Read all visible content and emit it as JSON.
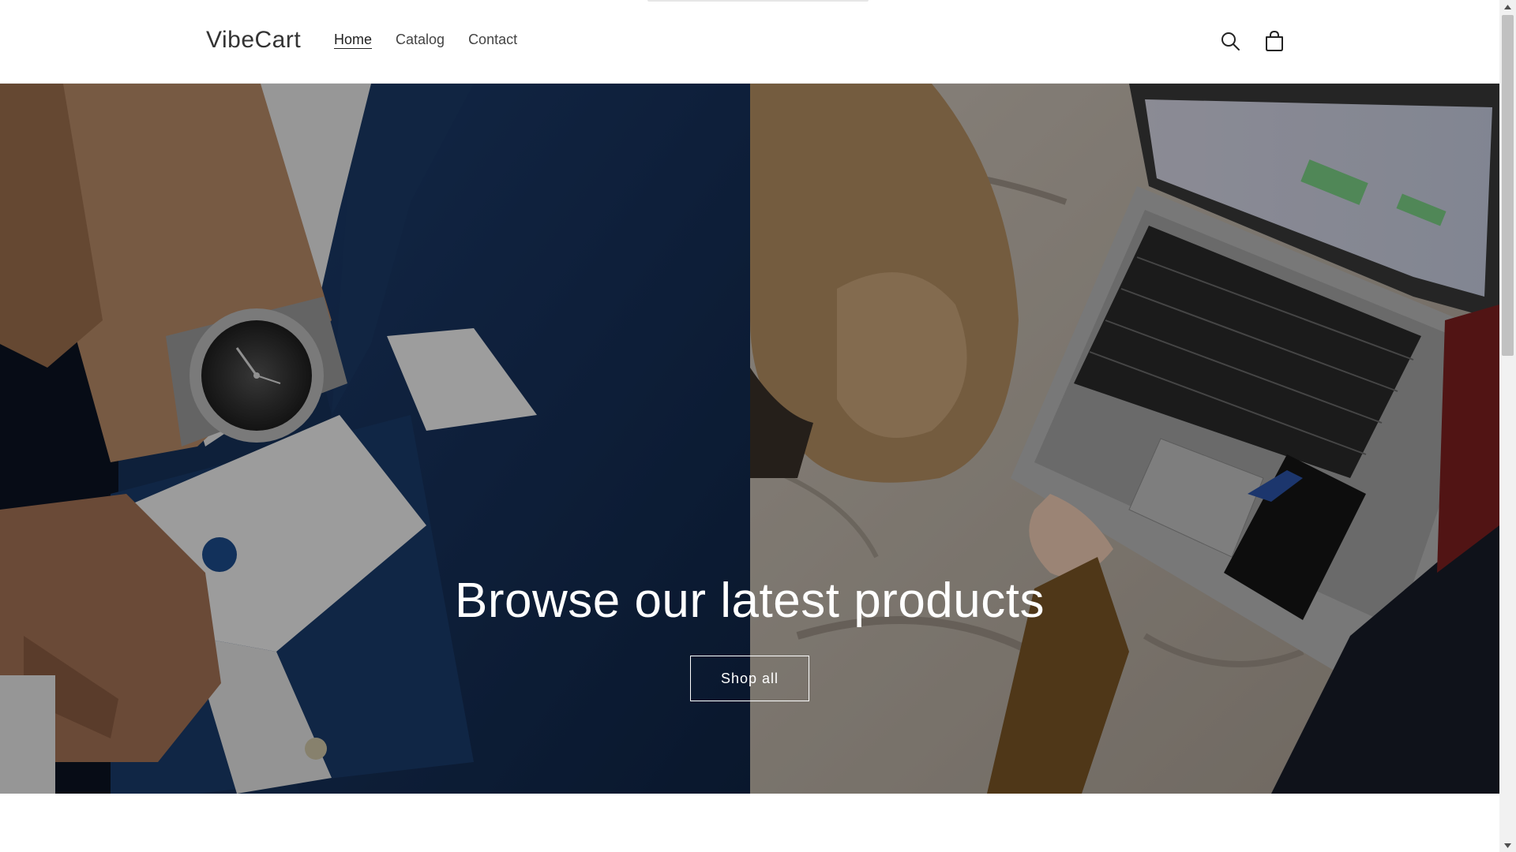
{
  "header": {
    "logo": "VibeCart",
    "nav": [
      {
        "label": "Home",
        "active": true
      },
      {
        "label": "Catalog",
        "active": false
      },
      {
        "label": "Contact",
        "active": false
      }
    ],
    "icons": [
      "search-icon",
      "cart-icon"
    ]
  },
  "hero": {
    "title": "Browse our latest products",
    "button_label": "Shop all",
    "left_image": "man-suit-watch-image",
    "right_image": "dog-laptop-image"
  },
  "colors": {
    "text": "#333333",
    "background": "#ffffff",
    "overlay": "#000000"
  }
}
